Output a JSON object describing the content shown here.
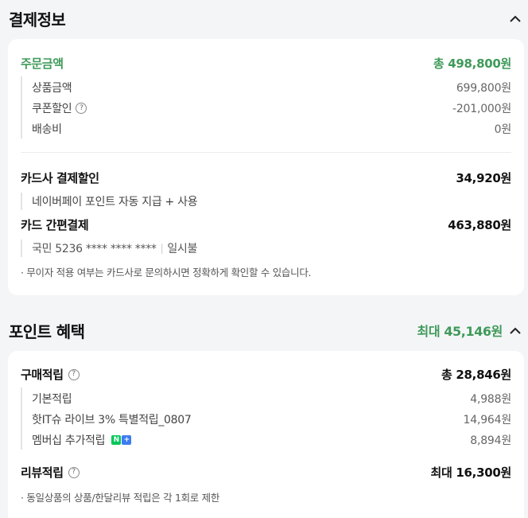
{
  "payment": {
    "title": "결제정보",
    "order_amount": {
      "label": "주문금액",
      "value": "총 498,800원"
    },
    "items": [
      {
        "label": "상품금액",
        "value": "699,800원",
        "help": false
      },
      {
        "label": "쿠폰할인",
        "value": "-201,000원",
        "help": true
      },
      {
        "label": "배송비",
        "value": "0원",
        "help": false
      }
    ],
    "card_discount": {
      "label": "카드사 결제할인",
      "value": "34,920원",
      "detail": "네이버페이 포인트 자동 지급 + 사용"
    },
    "card_pay": {
      "label": "카드 간편결제",
      "value": "463,880원",
      "card_info": "국민 5236 **** **** ****",
      "installment": "일시불"
    },
    "note": "· 무이자 적용 여부는 카드사로 문의하시면 정확하게 확인할 수 있습니다."
  },
  "points": {
    "title": "포인트 혜택",
    "max": "최대 45,146원",
    "purchase": {
      "label": "구매적립",
      "value": "총 28,846원"
    },
    "items": [
      {
        "label": "기본적립",
        "value": "4,988원"
      },
      {
        "label": "핫IT슈 라이브 3% 특별적립_0807",
        "value": "14,964원"
      },
      {
        "label": "멤버십 추가적립",
        "value": "8,894원"
      }
    ],
    "membership_badge": {
      "n": "N",
      "plus": "+",
      "n_color": "#03c75a",
      "plus_color": "#3d7bf0"
    },
    "review": {
      "label": "리뷰적립",
      "value": "최대 16,300원"
    },
    "note": "· 동일상품의 상품/한달리뷰 적립은 각 1회로 제한"
  },
  "icons": {
    "help": "question-circle-icon",
    "collapse": "chevron-up-icon"
  },
  "colors": {
    "accent_green": "#3f9a5a",
    "background": "#f4f5f7"
  }
}
